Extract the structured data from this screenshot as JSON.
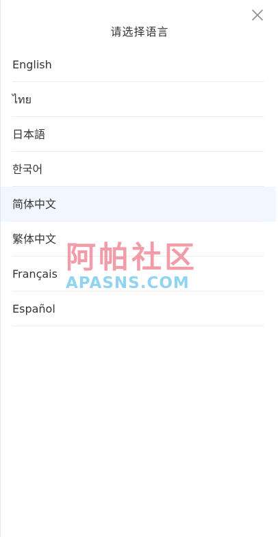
{
  "dialog": {
    "title": "请选择语言",
    "close_icon": "close-icon"
  },
  "languages": [
    {
      "label": "English",
      "selected": false
    },
    {
      "label": "ไทย",
      "selected": false
    },
    {
      "label": "日本語",
      "selected": false
    },
    {
      "label": "한국어",
      "selected": false
    },
    {
      "label": "简体中文",
      "selected": true
    },
    {
      "label": "繁体中文",
      "selected": false
    },
    {
      "label": "Français",
      "selected": false
    },
    {
      "label": "Español",
      "selected": false
    }
  ],
  "watermark": {
    "line1": "阿帕社区",
    "line2": "APASNS.COM"
  },
  "colors": {
    "selected_background": "#f2f6fe",
    "divider": "#ececec",
    "text": "#333333",
    "watermark_cn": "#f28b9b",
    "watermark_en": "#86d0f0"
  }
}
